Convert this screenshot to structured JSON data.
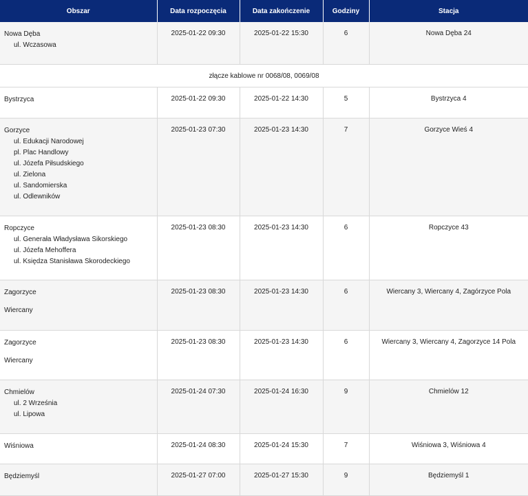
{
  "headers": [
    "Obszar",
    "Data rozpoczęcia",
    "Data zakończenie",
    "Godziny",
    "Stacja"
  ],
  "rows": [
    {
      "type": "data",
      "areas": [
        {
          "name": "Nowa Dęba",
          "streets": [
            "ul. Wczasowa"
          ]
        }
      ],
      "start": "2025-01-22 09:30",
      "end": "2025-01-22 15:30",
      "hours": "6",
      "station": "Nowa Dęba 24"
    },
    {
      "type": "note",
      "text": "złącze kablowe nr 0068/08, 0069/08"
    },
    {
      "type": "data",
      "areas": [
        {
          "name": "Bystrzyca",
          "streets": []
        }
      ],
      "start": "2025-01-22 09:30",
      "end": "2025-01-22 14:30",
      "hours": "5",
      "station": "Bystrzyca 4"
    },
    {
      "type": "data",
      "areas": [
        {
          "name": "Gorzyce",
          "streets": [
            "ul. Edukacji Narodowej",
            "pl. Plac Handlowy",
            "ul. Józefa Piłsudskiego",
            "ul. Zielona",
            "ul. Sandomierska",
            "ul. Odlewników"
          ]
        }
      ],
      "start": "2025-01-23 07:30",
      "end": "2025-01-23 14:30",
      "hours": "7",
      "station": "Gorzyce Wieś 4"
    },
    {
      "type": "data",
      "areas": [
        {
          "name": "Ropczyce",
          "streets": [
            "ul. Generała Władysława Sikorskiego",
            "ul. Józefa Mehoffera",
            "ul. Księdza Stanisława Skorodeckiego"
          ]
        }
      ],
      "start": "2025-01-23 08:30",
      "end": "2025-01-23 14:30",
      "hours": "6",
      "station": "Ropczyce 43"
    },
    {
      "type": "data",
      "areas": [
        {
          "name": "Zagorzyce",
          "streets": []
        },
        {
          "name": "Wiercany",
          "streets": []
        }
      ],
      "start": "2025-01-23 08:30",
      "end": "2025-01-23 14:30",
      "hours": "6",
      "station": "Wiercany 3, Wiercany 4, Zagórzyce Pola"
    },
    {
      "type": "data",
      "areas": [
        {
          "name": "Zagorzyce",
          "streets": []
        },
        {
          "name": "Wiercany",
          "streets": []
        }
      ],
      "start": "2025-01-23 08:30",
      "end": "2025-01-23 14:30",
      "hours": "6",
      "station": "Wiercany 3, Wiercany 4, Zagorzyce 14 Pola"
    },
    {
      "type": "data",
      "areas": [
        {
          "name": "Chmielów",
          "streets": [
            "ul. 2 Września",
            "ul. Lipowa"
          ]
        }
      ],
      "start": "2025-01-24 07:30",
      "end": "2025-01-24 16:30",
      "hours": "9",
      "station": "Chmielów 12"
    },
    {
      "type": "data",
      "areas": [
        {
          "name": "Wiśniowa",
          "streets": []
        }
      ],
      "start": "2025-01-24 08:30",
      "end": "2025-01-24 15:30",
      "hours": "7",
      "station": "Wiśniowa 3, Wiśniowa 4"
    },
    {
      "type": "data",
      "areas": [
        {
          "name": "Będziemyśl",
          "streets": []
        }
      ],
      "start": "2025-01-27 07:00",
      "end": "2025-01-27 15:30",
      "hours": "9",
      "station": "Będziemyśl 1"
    }
  ]
}
